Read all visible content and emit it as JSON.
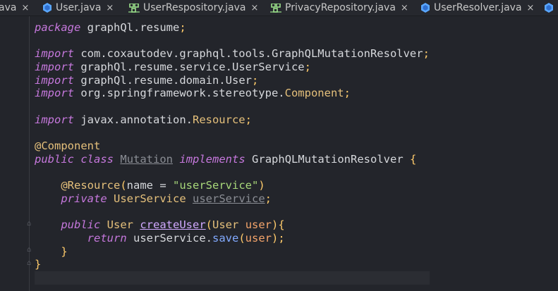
{
  "tabs": [
    {
      "label": "ava",
      "icon": "none",
      "active": false
    },
    {
      "label": "User.java",
      "icon": "class-icon",
      "active": false
    },
    {
      "label": "UserRespository.java",
      "icon": "interface-icon",
      "active": false
    },
    {
      "label": "PrivacyRepository.java",
      "icon": "interface-icon",
      "active": false
    },
    {
      "label": "UserResolver.java",
      "icon": "class-icon",
      "active": false
    },
    {
      "label": "",
      "icon": "class-icon",
      "active": false
    }
  ],
  "close_glyph": "×",
  "code": {
    "package_kw": "package",
    "package_name": "graphQl.resume",
    "import_kw": "import",
    "imports": [
      {
        "path": "com.coxautodev.graphql.tools.",
        "cls": "GraphQLMutationResolver"
      },
      {
        "path": "graphQl.resume.service.",
        "cls": "UserService"
      },
      {
        "path": "graphQl.resume.domain.",
        "cls": "User"
      },
      {
        "path": "org.springframework.stereotype.",
        "cls": "Component"
      },
      {
        "path": "javax.annotation.",
        "cls": "Resource"
      }
    ],
    "annotation_component": "@Component",
    "public_kw": "public",
    "class_kw": "class",
    "class_name": "Mutation",
    "implements_kw": "implements",
    "interface_name": "GraphQLMutationResolver",
    "resource_annotation": "@Resource",
    "resource_param": "name",
    "resource_value": "\"userService\"",
    "private_kw": "private",
    "field_type": "UserService",
    "field_name": "userService",
    "method_return": "User",
    "method_name": "createUser",
    "param_type": "User",
    "param_name": "user",
    "return_kw": "return",
    "return_target": "userService",
    "return_call": "save",
    "return_arg": "user"
  },
  "colors": {
    "background": "#23252b",
    "keyword": "#c678dd",
    "string": "#a8d87a",
    "method": "#82aaff"
  }
}
